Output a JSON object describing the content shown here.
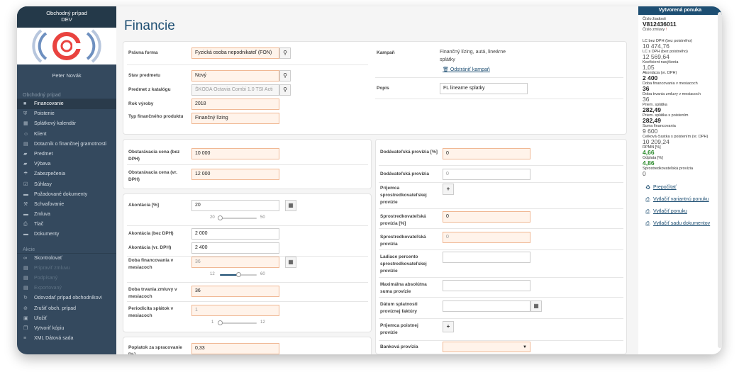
{
  "sidebar": {
    "title": "Obchodný prípad",
    "env": "DEV",
    "user": "Peter Novák",
    "section1": "Obchodný prípad",
    "items": [
      {
        "label": "Financovanie",
        "icon": "square-icon"
      },
      {
        "label": "Poistenie",
        "icon": "shield-icon"
      },
      {
        "label": "Splátkový kalendár",
        "icon": "calendar-icon"
      },
      {
        "label": "Klient",
        "icon": "person-icon"
      },
      {
        "label": "Dotazník o finančnej gramotnosti",
        "icon": "document-icon"
      },
      {
        "label": "Predmet",
        "icon": "car-icon"
      },
      {
        "label": "Výbava",
        "icon": "car-icon"
      },
      {
        "label": "Zabezpečenia",
        "icon": "umbrella-icon"
      },
      {
        "label": "Súhlasy",
        "icon": "checkbox-icon"
      },
      {
        "label": "Požadované dokumenty",
        "icon": "folder-icon"
      },
      {
        "label": "Schvaľovanie",
        "icon": "gavel-icon"
      },
      {
        "label": "Zmluva",
        "icon": "folder-icon"
      },
      {
        "label": "Tlač",
        "icon": "print-icon"
      },
      {
        "label": "Dokumenty",
        "icon": "folder-icon"
      }
    ],
    "section2": "Akcie",
    "actions": [
      {
        "label": "Skontrolovať",
        "icon": "glasses-icon",
        "dim": false
      },
      {
        "label": "Pripraviť zmluvu",
        "icon": "document-icon",
        "dim": true
      },
      {
        "label": "Podpísaný",
        "icon": "document-icon",
        "dim": true
      },
      {
        "label": "Exportovaný",
        "icon": "document-icon",
        "dim": true
      },
      {
        "label": "Odovzdať prípad obchodníkovi",
        "icon": "refresh-icon",
        "dim": false
      },
      {
        "label": "Zrušiť obch. prípad",
        "icon": "ban-icon",
        "dim": false
      },
      {
        "label": "Uložiť",
        "icon": "save-icon",
        "dim": false
      },
      {
        "label": "Vytvoriť kópiu",
        "icon": "copy-icon",
        "dim": false
      },
      {
        "label": "XML Dátová sada",
        "icon": "database-icon",
        "dim": false
      }
    ]
  },
  "main": {
    "title": "Financie",
    "top": {
      "pravna_forma_label": "Právna forma",
      "pravna_forma": "Fyzická osoba nepodnikateľ (FON)",
      "stav_label": "Stav predmetu",
      "stav": "Nový",
      "predmet_label": "Predmet z katalógu",
      "predmet": "ŠKODA Octavia Combi 1.0 TSI Acti",
      "rok_label": "Rok výroby",
      "rok": "2018",
      "typ_label": "Typ finančného produktu",
      "typ": "Finančný lízing",
      "kampan_label": "Kampaň",
      "kampan": "Finančný lízing, autá, lineárne splátky",
      "odstranit": "Odstrániť kampaň",
      "popis_label": "Popis",
      "popis": "FL linearne splatky"
    },
    "cena": {
      "bez_label": "Obstarávacia cena (bez DPH)",
      "bez": "10 000",
      "vr_label": "Obstarávacia cena (vr. DPH)",
      "vr": "12 000"
    },
    "akont": {
      "pct_label": "Akontácia [%]",
      "pct": "20",
      "pct_min": "20",
      "pct_max": "50",
      "pct_pos": 0.0,
      "bez_label": "Akontácia (bez DPH)",
      "bez": "2 000",
      "vr_label": "Akontácia (vr. DPH)",
      "vr": "2 400",
      "doba_label": "Doba financovania v mesiacoch",
      "doba": "36",
      "doba_min": "12",
      "doba_max": "60",
      "doba_pos": 0.5,
      "trvanie_label": "Doba trvania zmluvy v mesiacoch",
      "trvanie": "36",
      "period_label": "Periodicita splátok v mesiacoch",
      "period": "1",
      "period_min": "1",
      "period_max": "12",
      "period_pos": 0.0
    },
    "poplatok": {
      "label": "Poplatok za spracovanie [%]",
      "value": "0,33"
    },
    "provizia": {
      "dod_pct_label": "Dodávateľská provízia [%]",
      "dod_pct": "0",
      "dod_label": "Dodávateľská provízia",
      "dod": "0",
      "prijemca_sp_label": "Príjemca sprostredkovateľskej provízie",
      "sp_pct_label": "Sprostredkovateľská provízia [%]",
      "sp_pct": "0",
      "sp_label": "Sprostredkovateľská provízia",
      "sp": "0",
      "ladiace_label": "Ladiace percento sprostredkovateľskej provízie",
      "ladiace": "",
      "max_label": "Maximálna absolútna suma provízie",
      "max": "",
      "datum_label": "Dátum splatnosti províznej faktúry",
      "datum": "",
      "prijemca_po_label": "Príjemca poistnej provízie",
      "bank_label": "Banková provízia",
      "bank": ""
    }
  },
  "right": {
    "header": "Vytvorená ponuka",
    "cislo_ziadosti_label": "Číslo žiadosti",
    "cislo_ziadosti": "V812436011",
    "cislo_zmluvy_label": "Číslo zmluvy",
    "required_mark": "!",
    "stats": [
      {
        "label": "LC bez DPH (bez poistného)",
        "value": "10 474,76",
        "style": ""
      },
      {
        "label": "LC s DPH (bez poistného)",
        "value": "12 569,64",
        "style": ""
      },
      {
        "label": "Koeficient navýšenia",
        "value": "1,05",
        "style": ""
      },
      {
        "label": "Akontácia (vr. DPH)",
        "value": "2 400",
        "style": "b"
      },
      {
        "label": "Doba financovania v mesiacoch",
        "value": "36",
        "style": "b"
      },
      {
        "label": "Doba trvania zmluvy v mesiacoch",
        "value": "36",
        "style": ""
      },
      {
        "label": "Priem. splátka",
        "value": "282,49",
        "style": "b"
      },
      {
        "label": "Priem. splátka s poistením",
        "value": "282,49",
        "style": "b"
      },
      {
        "label": "Suma financovania",
        "value": "9 600",
        "style": ""
      },
      {
        "label": "Celková čiastka s poistením (vr. DPH)",
        "value": "10 209,24",
        "style": ""
      },
      {
        "label": "RPMN [%]",
        "value": "4,66",
        "style": "g"
      },
      {
        "label": "Odplata [%]",
        "value": "4,86",
        "style": "g"
      },
      {
        "label": "Sprostredkovateľská provízia",
        "value": "0",
        "style": ""
      }
    ],
    "actions": [
      {
        "label": "Prepočítať",
        "icon": "recycle-icon"
      },
      {
        "label": "Vytlačiť variantnú ponuku",
        "icon": "print-icon"
      },
      {
        "label": "Vytlačiť ponuku",
        "icon": "print-icon"
      },
      {
        "label": "Vytlačiť sadu dokumentov",
        "icon": "print-icon"
      }
    ]
  }
}
